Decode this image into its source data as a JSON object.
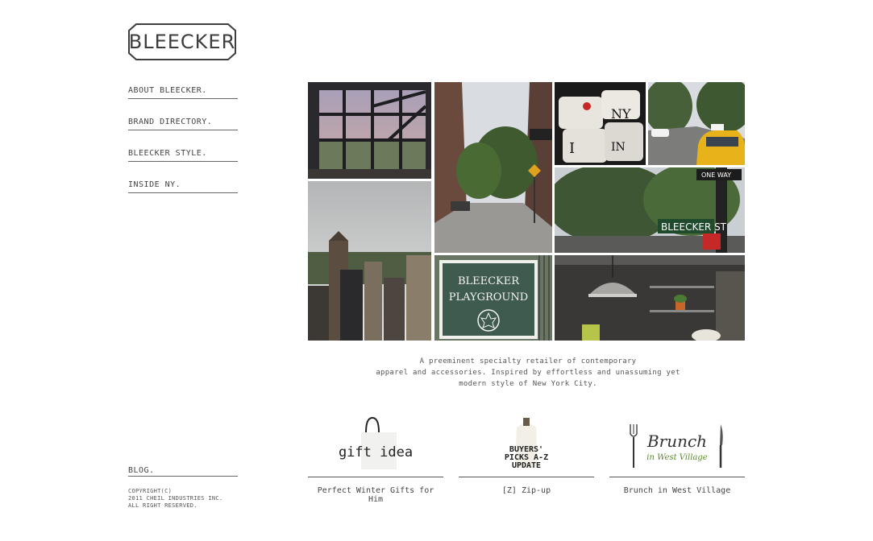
{
  "brand": {
    "logo_text": "BLEECKER"
  },
  "nav": [
    {
      "label": "ABOUT BLEECKER."
    },
    {
      "label": "BRAND DIRECTORY."
    },
    {
      "label": "BLEECKER STYLE."
    },
    {
      "label": "INSIDE NY."
    }
  ],
  "gallery": {
    "photos": [
      {
        "name": "window-photo",
        "icon": "window-photo"
      },
      {
        "name": "street-photo",
        "icon": "street-photo"
      },
      {
        "name": "mugs-photo",
        "icon": "mugs-photo",
        "text": "I ♥ NY"
      },
      {
        "name": "taxi-photo",
        "icon": "taxi-photo"
      },
      {
        "name": "central-park-photo",
        "icon": "city-photo"
      },
      {
        "name": "street-sign-photo",
        "icon": "street-sign-photo",
        "text": "BLEECKER ST",
        "text2": "ONE WAY"
      },
      {
        "name": "playground-sign-photo",
        "icon": "playground-sign",
        "text": "BLEECKER",
        "text2": "PLAYGROUND"
      },
      {
        "name": "store-interior-photo",
        "icon": "interior-photo"
      }
    ]
  },
  "description": {
    "lines": [
      "A preeminent specialty retailer of contemporary",
      "apparel and accessories. Inspired by effortless and unassuming yet",
      "modern style of New York City."
    ]
  },
  "features": [
    {
      "image_text": "gift idea",
      "caption": "Perfect Winter Gifts for Him"
    },
    {
      "image_text": "BUYERS' PICKS A-Z UPDATE",
      "image_lines": [
        "BUYERS'",
        "PICKS A-Z",
        "UPDATE"
      ],
      "caption": "[Z] Zip-up"
    },
    {
      "image_text": "Brunch",
      "image_sub": "in West Village",
      "caption": "Brunch in West Village"
    }
  ],
  "footer": {
    "blog_label": "BLOG.",
    "copyright": [
      "COPYRIGHT(C)",
      "2011 CHEIL INDUSTRIES INC.",
      "ALL RIGHT RESERVED."
    ]
  },
  "colors": {
    "text": "#333333",
    "rule": "#666666",
    "brand_green": "#5a8a2a",
    "sign_green": "#3f5b50"
  }
}
